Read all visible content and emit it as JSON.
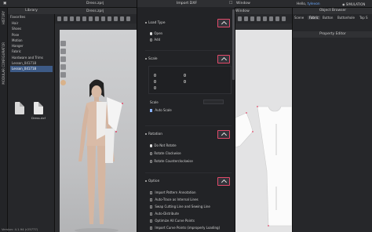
{
  "topbar": {
    "title_3d": "Dress.zprj",
    "window_label": "Window",
    "hello_prefix": "Hello,",
    "user": "tylevon",
    "simulation": "SIMULATION"
  },
  "vertical_strip": {
    "history": "HISTORY",
    "modular": "MODULAR CONFIGURATOR"
  },
  "library": {
    "title": "Library",
    "favorites": "Favorites",
    "items": [
      "Hair",
      "Shoes",
      "Pose",
      "Motion",
      "Hanger",
      "Fabric",
      "Hardware and Trims",
      "Lesson_041718",
      "Lesson_041718"
    ],
    "selected_index": 8,
    "files": [
      {
        "label": ""
      },
      {
        "label": "Dress.dxf"
      }
    ]
  },
  "dialog": {
    "title": "Import DXF",
    "load_type": {
      "label": "Load Type",
      "options": [
        "Open",
        "Add"
      ],
      "selected": 0
    },
    "scale": {
      "label": "Scale",
      "scale_label": "Scale",
      "auto_scale": "Auto Scale",
      "auto_scale_checked": true
    },
    "rotation": {
      "label": "Rotation",
      "options": [
        "Do Not Rotate",
        "Rotate Clockwise",
        "Rotate Counterclockwise"
      ],
      "selected": 0
    },
    "option": {
      "label": "Option",
      "items": [
        {
          "label": "Import Pattern Annotation",
          "checked": false
        },
        {
          "label": "Auto-Trace as Internal Lines",
          "checked": false
        },
        {
          "label": "Swap Cutting Line and Sewing Line",
          "checked": false
        },
        {
          "label": "Auto-Distribute",
          "checked": false
        },
        {
          "label": "Optimize All Curve Points",
          "checked": false
        },
        {
          "label": "Import Curve Points (improperly Loading)",
          "checked": false
        }
      ]
    }
  },
  "object_browser": {
    "title": "Object Browser",
    "tabs": [
      "Scene",
      "Fabric",
      "Button",
      "Buttonhole",
      "Top S"
    ],
    "selected_tab": 1,
    "property_editor": "Property Editor"
  },
  "status": {
    "version": "Version: 4.1.94 (r25777)"
  },
  "colors": {
    "highlight": "#e24a6a",
    "accent": "#3d5a86",
    "user": "#6aa9ff"
  }
}
